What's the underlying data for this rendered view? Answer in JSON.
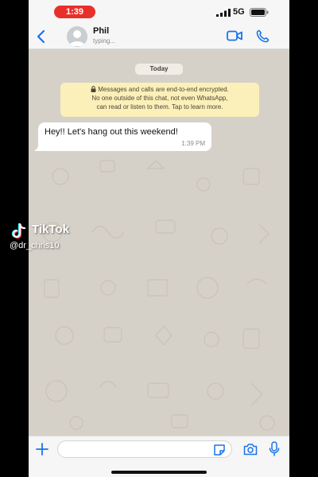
{
  "status_bar": {
    "time": "1:39",
    "network": "5G",
    "time_pill_color": "#e8302b"
  },
  "header": {
    "contact_name": "Phil",
    "contact_status": "typing...",
    "icons": [
      "back-chevron-icon",
      "avatar",
      "video-call-icon",
      "phone-call-icon"
    ],
    "accent_color": "#1a73e8"
  },
  "chat": {
    "date_label": "Today",
    "encryption_notice": {
      "line1": "Messages and calls are end-to-end encrypted.",
      "line2": "No one outside of this chat, not even WhatsApp,",
      "line3": "can read or listen to them. Tap to learn more."
    },
    "messages": [
      {
        "text": "Hey!! Let's hang out this weekend!",
        "time": "1:39 PM",
        "direction": "incoming"
      }
    ],
    "notice_color": "#fbf0b9",
    "wallpaper_color": "#d6d1c8"
  },
  "input_bar": {
    "placeholder": "",
    "value": "",
    "icons": [
      "plus-icon",
      "sticker-icon",
      "camera-icon",
      "microphone-icon"
    ]
  },
  "watermark": {
    "brand": "TikTok",
    "handle": "@dr_chris10"
  }
}
